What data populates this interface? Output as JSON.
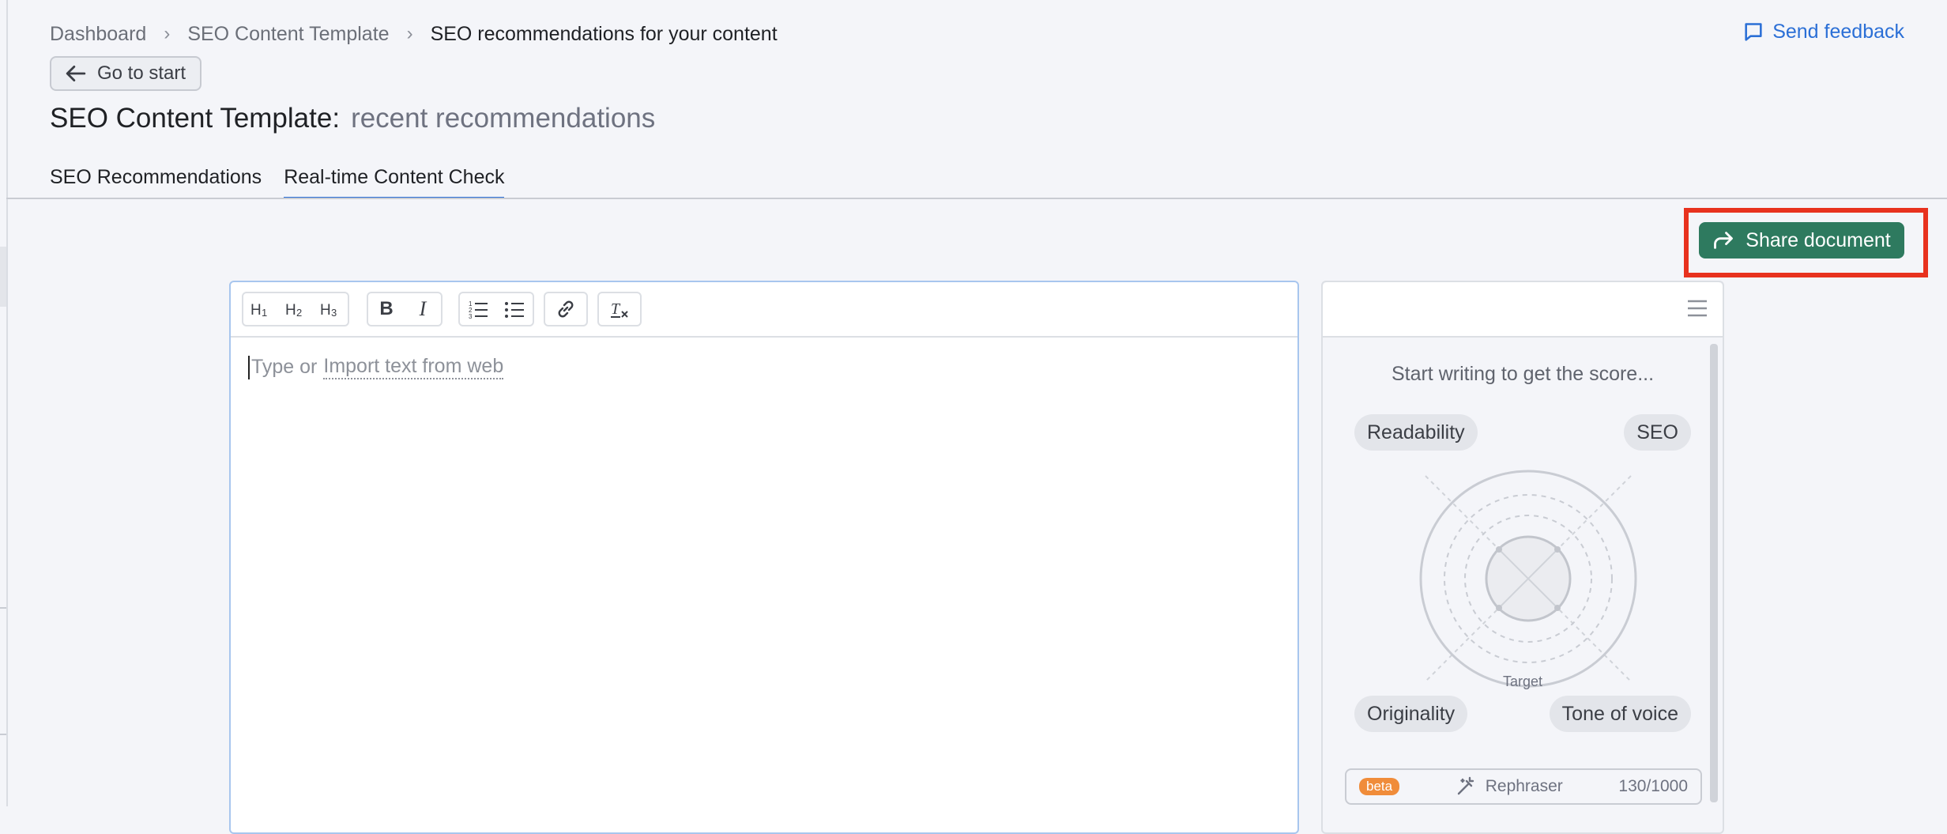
{
  "breadcrumb": {
    "items": [
      "Dashboard",
      "SEO Content Template",
      "SEO recommendations for your content"
    ]
  },
  "header": {
    "feedback_label": "Send feedback",
    "go_start_label": "Go to start",
    "title": "SEO Content Template:",
    "subtitle": "recent recommendations"
  },
  "tabs": [
    {
      "label": "SEO Recommendations",
      "active": false
    },
    {
      "label": "Real-time Content Check",
      "active": true
    }
  ],
  "share": {
    "label": "Share document"
  },
  "editor": {
    "toolbar": {
      "heading_labels": [
        "H1",
        "H2",
        "H3"
      ],
      "bold": "B",
      "italic": "I"
    },
    "placeholder_prefix": "Type or",
    "placeholder_link": "Import text from web"
  },
  "score_panel": {
    "message": "Start writing to get the score...",
    "readability": "Readability",
    "seo": "SEO",
    "originality": "Originality",
    "tone": "Tone of voice",
    "target": "Target",
    "rephraser": {
      "badge": "beta",
      "label": "Rephraser",
      "count": "130/1000"
    }
  },
  "colors": {
    "accent": "#2b6fd6",
    "share_button": "#2e7a5f",
    "highlight": "#e8321e",
    "beta_badge": "#f08c3a"
  }
}
